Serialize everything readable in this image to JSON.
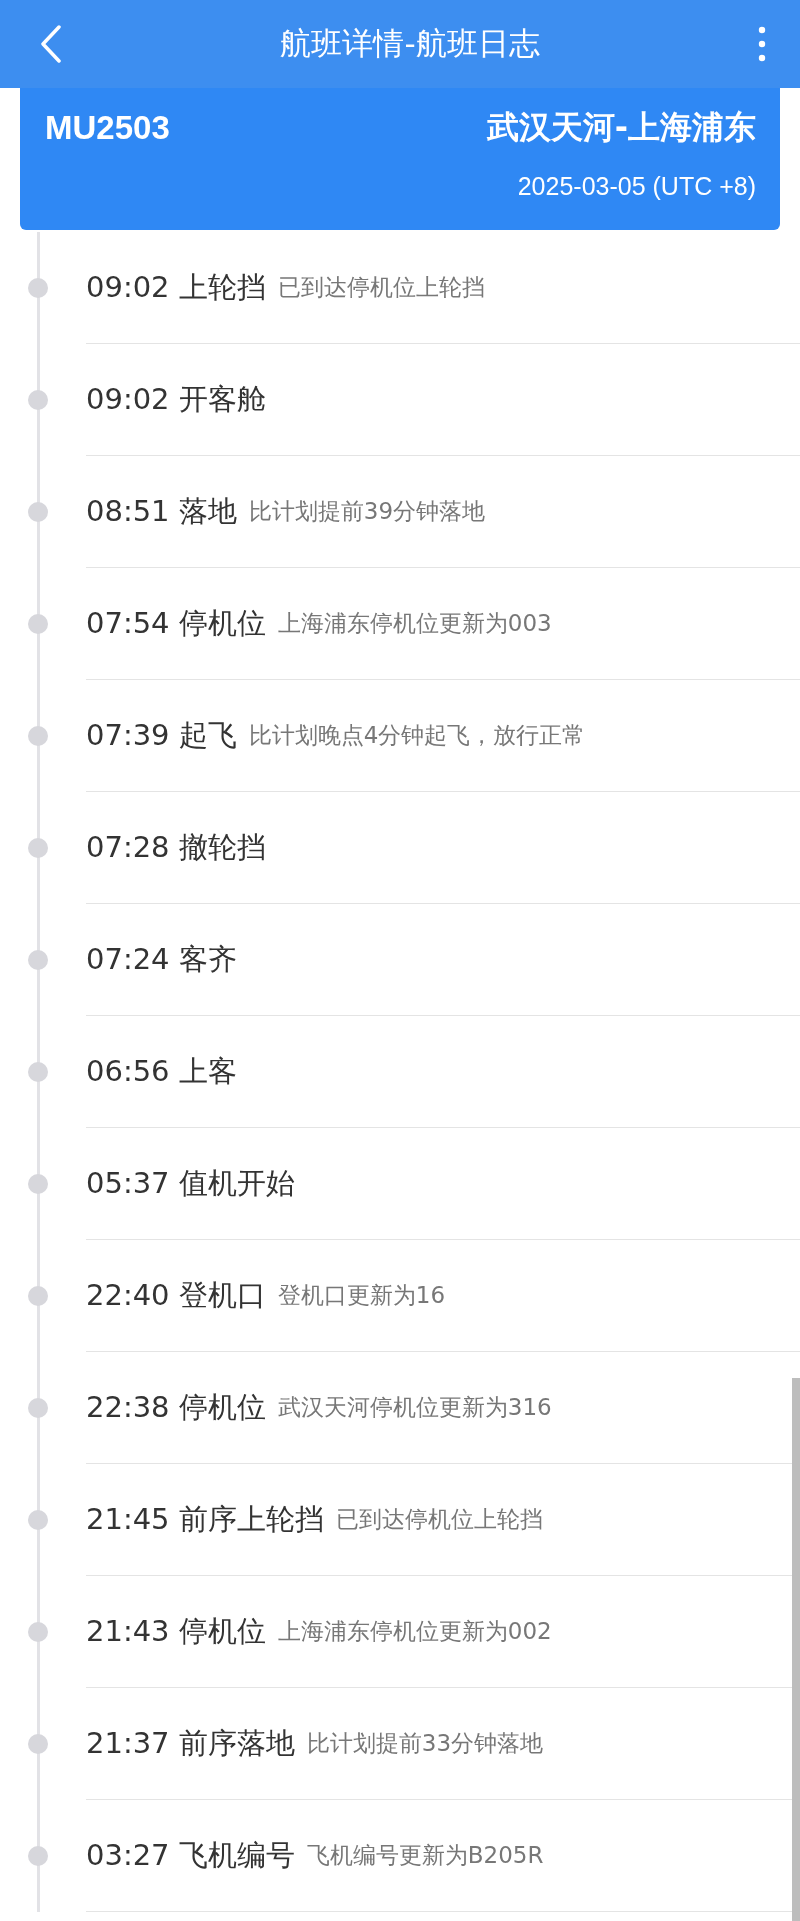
{
  "header": {
    "title": "航班详情-航班日志"
  },
  "flight": {
    "number": "MU2503",
    "route": "武汉天河-上海浦东",
    "date": "2025-03-05 (UTC +8)"
  },
  "events": [
    {
      "time": "09:02",
      "event": "上轮挡",
      "detail": "已到达停机位上轮挡"
    },
    {
      "time": "09:02",
      "event": "开客舱"
    },
    {
      "time": "08:51",
      "event": "落地",
      "detail": "比计划提前39分钟落地"
    },
    {
      "time": "07:54",
      "event": "停机位",
      "detail": "上海浦东停机位更新为003"
    },
    {
      "time": "07:39",
      "event": "起飞",
      "detail": "比计划晚点4分钟起飞，放行正常"
    },
    {
      "time": "07:28",
      "event": "撤轮挡"
    },
    {
      "time": "07:24",
      "event": "客齐"
    },
    {
      "time": "06:56",
      "event": "上客"
    },
    {
      "time": "05:37",
      "event": "值机开始"
    },
    {
      "time": "22:40",
      "event": "登机口",
      "detail": "登机口更新为16"
    },
    {
      "time": "22:38",
      "event": "停机位",
      "detail": "武汉天河停机位更新为316"
    },
    {
      "time": "21:45",
      "event": "前序上轮挡",
      "detail": "已到达停机位上轮挡"
    },
    {
      "time": "21:43",
      "event": "停机位",
      "detail": "上海浦东停机位更新为002"
    },
    {
      "time": "21:37",
      "event": "前序落地",
      "detail": "比计划提前33分钟落地"
    },
    {
      "time": "03:27",
      "event": "飞机编号",
      "detail": "飞机编号更新为B205R"
    }
  ]
}
